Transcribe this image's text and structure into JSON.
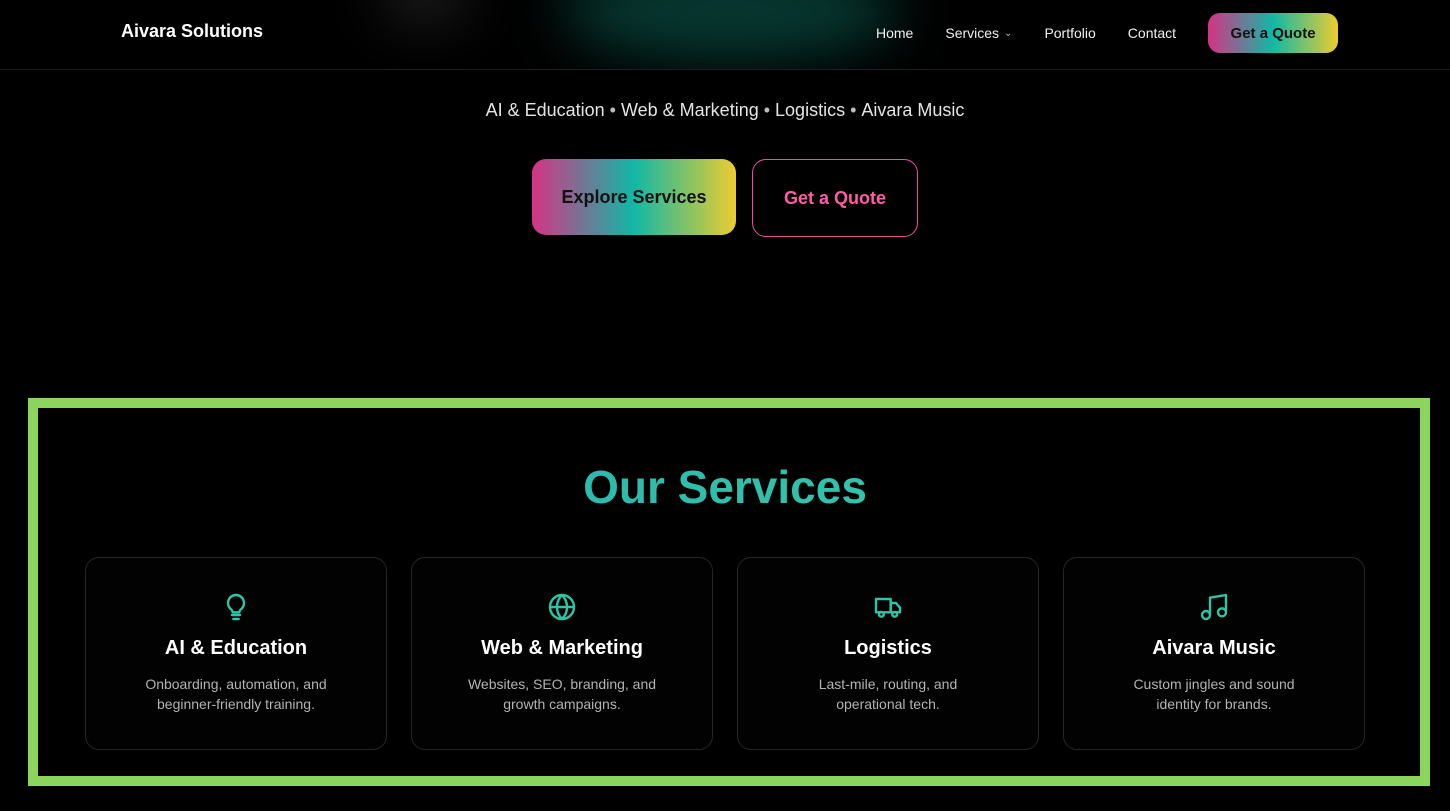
{
  "header": {
    "brand": "Aivara Solutions",
    "nav": [
      {
        "label": "Home"
      },
      {
        "label": "Services",
        "has_dropdown": true
      },
      {
        "label": "Portfolio"
      },
      {
        "label": "Contact"
      }
    ],
    "cta_label": "Get a Quote"
  },
  "hero": {
    "tagline": [
      "AI & Education",
      "Web & Marketing",
      "Logistics",
      "Aivara Music"
    ],
    "separator": "•",
    "primary_button": "Explore Services",
    "secondary_button": "Get a Quote"
  },
  "services": {
    "title": "Our Services",
    "highlight_color": "#8bd45d",
    "accent_color": "#2ec4a6",
    "cards": [
      {
        "icon": "lightbulb-icon",
        "title": "AI & Education",
        "description": "Onboarding, automation, and beginner-friendly training."
      },
      {
        "icon": "globe-icon",
        "title": "Web & Marketing",
        "description": "Websites, SEO, branding, and growth campaigns."
      },
      {
        "icon": "truck-icon",
        "title": "Logistics",
        "description": "Last-mile, routing, and operational tech."
      },
      {
        "icon": "music-note-icon",
        "title": "Aivara Music",
        "description": "Custom jingles and sound identity for brands."
      }
    ]
  },
  "colors": {
    "gradient": [
      "#d63384",
      "#12b8a6",
      "#eccc2f"
    ],
    "outline_pink": "#ff5ca8",
    "background": "#000000"
  }
}
